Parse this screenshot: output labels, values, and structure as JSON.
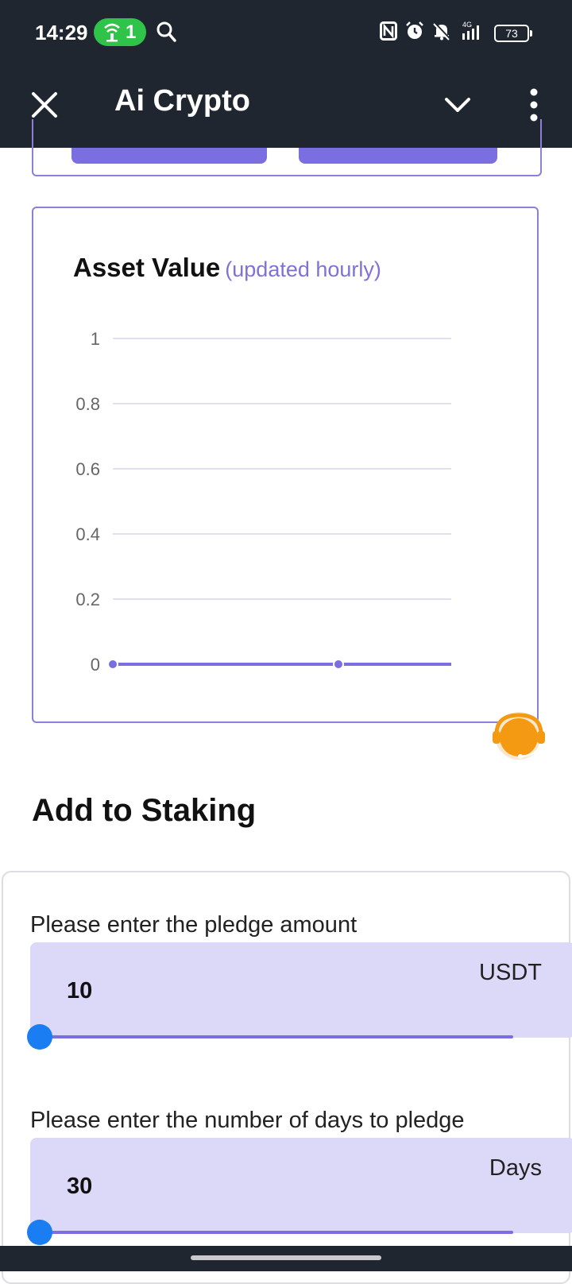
{
  "status_bar": {
    "time": "14:29",
    "hotspot_count": "1",
    "network": "4G",
    "battery": "73"
  },
  "app_bar": {
    "title": "Ai Crypto"
  },
  "chart_card": {
    "title": "Asset Value",
    "subtitle": "(updated hourly)"
  },
  "chart_data": {
    "type": "line",
    "title": "Asset Value",
    "subtitle": "(updated hourly)",
    "y_ticks": [
      "1",
      "0.8",
      "0.6",
      "0.4",
      "0.2",
      "0"
    ],
    "ylim": [
      0,
      1
    ],
    "grid": true,
    "series": [
      {
        "points": [
          0,
          0
        ],
        "line_color": "#7a6ee0",
        "marker_color": "#7a6ee0"
      }
    ]
  },
  "staking": {
    "section_title": "Add to Staking",
    "amount_label": "Please enter the pledge amount",
    "amount_value": "10",
    "amount_unit": "USDT",
    "amount_slider_fraction": 0,
    "days_label": "Please enter the number of days to pledge",
    "days_value": "30",
    "days_unit": "Days",
    "days_slider_fraction": 0
  },
  "colors": {
    "header_bg": "#1f2630",
    "accent": "#7a6ee0",
    "field_bg": "#dcd8f7",
    "slider_thumb": "#1a7ef2",
    "support_icon": "#f39a12"
  },
  "icons": {
    "close": "close-icon",
    "chevron": "chevron-down-icon",
    "more": "more-vertical-icon",
    "support": "customer-support-headset-icon"
  }
}
